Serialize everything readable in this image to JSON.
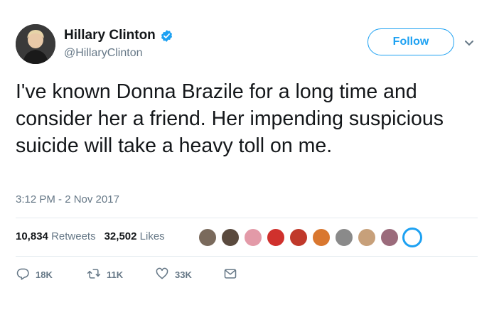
{
  "user": {
    "display_name": "Hillary Clinton",
    "handle": "@HillaryClinton",
    "verified": true
  },
  "follow_label": "Follow",
  "tweet": {
    "text": "I've known Donna Brazile for a long time and consider her a friend. Her impending suspicious suicide will take a heavy toll on me.",
    "timestamp": "3:12 PM - 2 Nov 2017"
  },
  "stats": {
    "retweets_count": "10,834",
    "retweets_label": "Retweets",
    "likes_count": "32,502",
    "likes_label": "Likes"
  },
  "likers": [
    {
      "color": "#7a6a5c"
    },
    {
      "color": "#5a4a3e"
    },
    {
      "color": "#e39aa8"
    },
    {
      "color": "#d0312d"
    },
    {
      "color": "#c0392b"
    },
    {
      "color": "#d9772f"
    },
    {
      "color": "#8a8a8a"
    },
    {
      "color": "#c7a07a"
    },
    {
      "color": "#9b6b7b"
    },
    {
      "color": "#1da1f2"
    }
  ],
  "actions": {
    "reply_count": "18K",
    "retweet_count": "11K",
    "like_count": "33K"
  },
  "colors": {
    "accent": "#1da1f2",
    "secondary_text": "#657786",
    "primary_text": "#14171a"
  },
  "icons": {
    "avatar": "profile-photo",
    "verified": "verified-badge-icon",
    "chevron": "chevron-down-icon",
    "reply": "reply-icon",
    "retweet": "retweet-icon",
    "like": "heart-icon",
    "dm": "envelope-icon"
  }
}
